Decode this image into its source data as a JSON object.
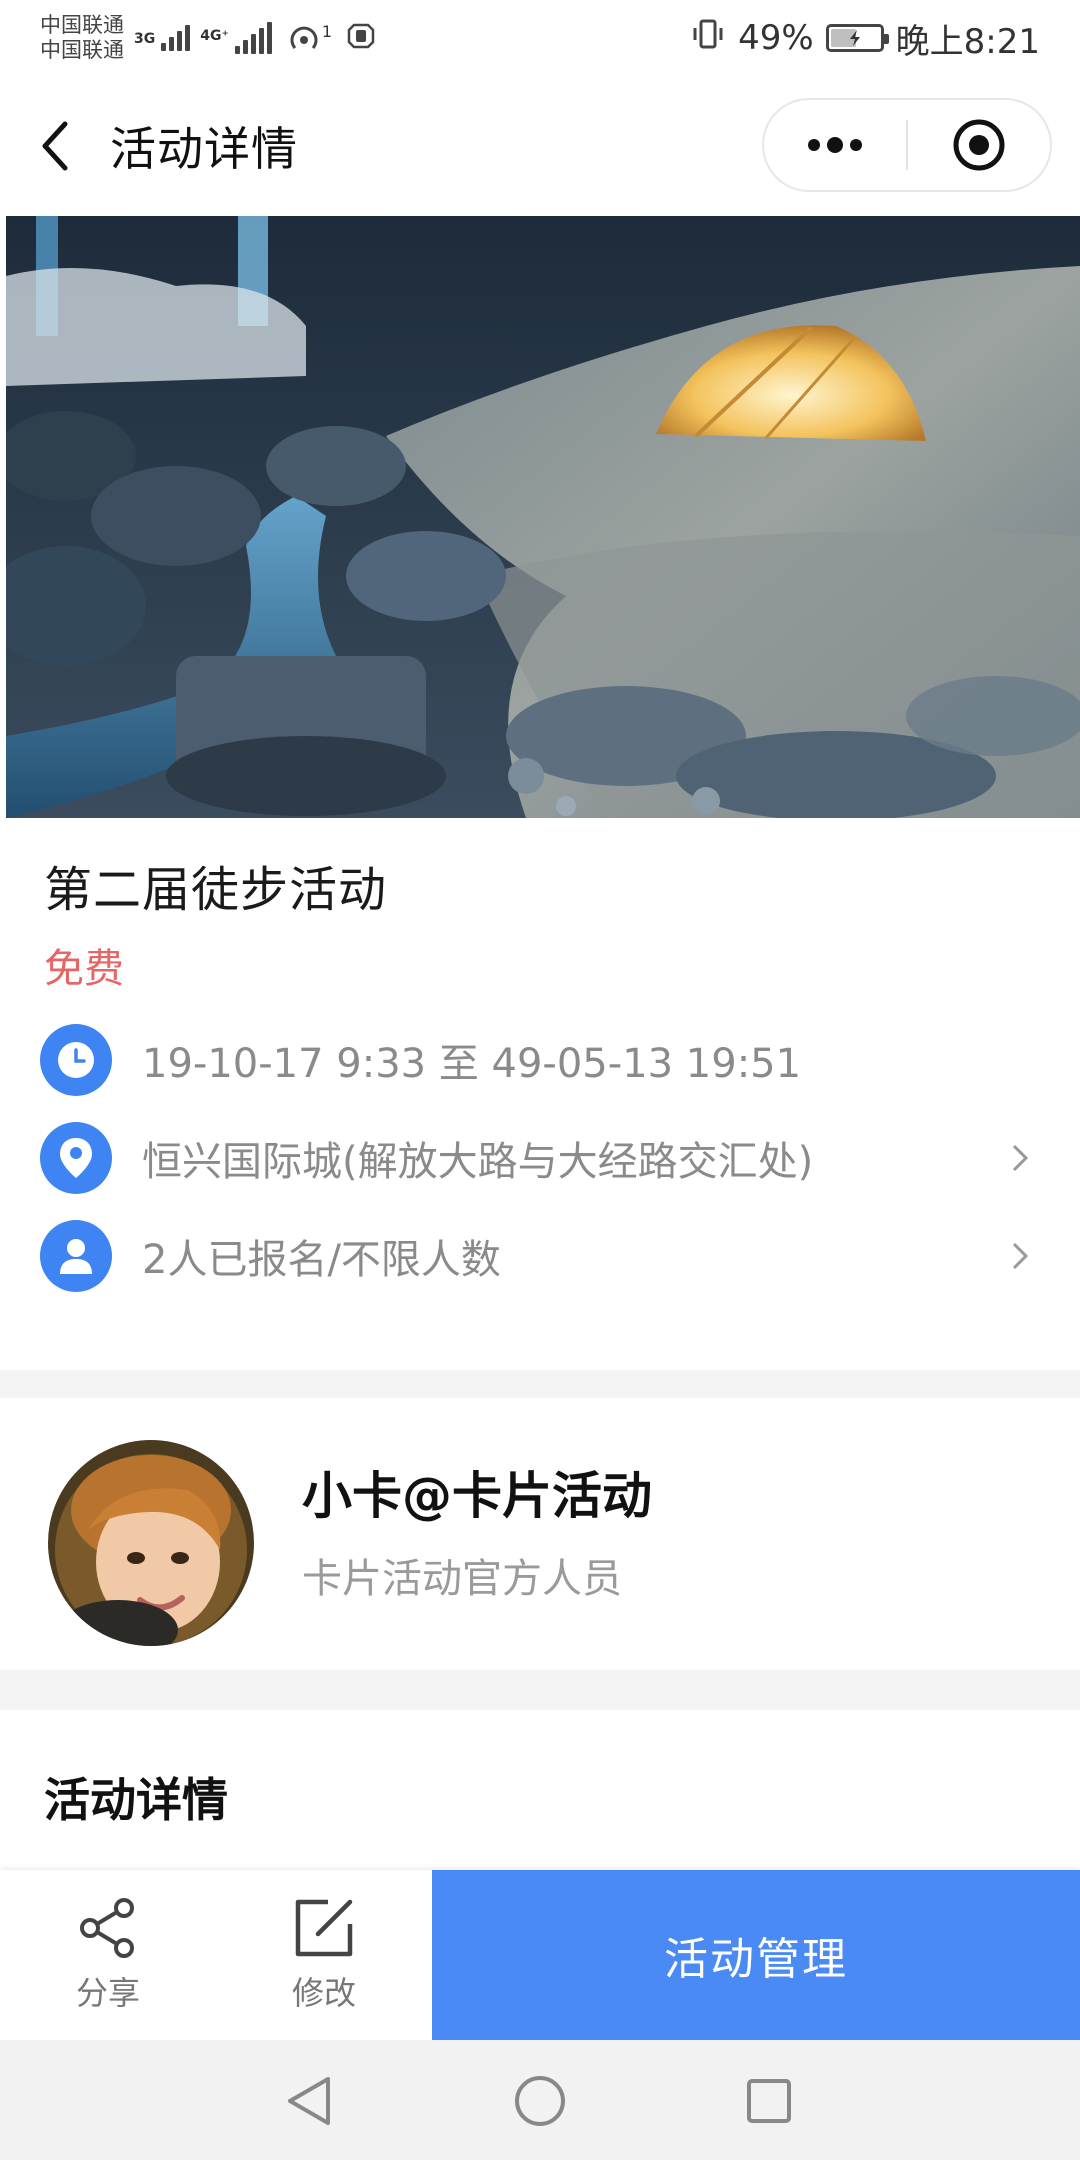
{
  "status_bar": {
    "carrier_1": "中国联通",
    "carrier_2": "中国联通",
    "network_1": "3G",
    "network_2": "4G⁺",
    "hotspot_count": "1",
    "battery_percent": "49%",
    "battery_level": 0.49,
    "time": "晚上8:21"
  },
  "nav": {
    "title": "活动详情"
  },
  "activity": {
    "title": "第二届徒步活动",
    "price": "免费",
    "time_range": "19-10-17 9:33 至 49-05-13 19:51",
    "location": "恒兴国际城(解放大路与大经路交汇处)",
    "signup": "2人已报名/不限人数"
  },
  "organizer": {
    "name": "小卡@卡片活动",
    "role": "卡片活动官方人员"
  },
  "details": {
    "title": "活动详情"
  },
  "action_bar": {
    "share_label": "分享",
    "edit_label": "修改",
    "manage_label": "活动管理"
  },
  "colors": {
    "accent": "#4a8af4",
    "icon_blue": "#3e84f2",
    "price_red": "#e86565"
  },
  "icons": [
    "back-arrow",
    "more-dots",
    "target-circle",
    "clock",
    "location-pin",
    "person",
    "chevron-right",
    "share",
    "edit",
    "triangle-back",
    "circle-home",
    "square-recents"
  ]
}
